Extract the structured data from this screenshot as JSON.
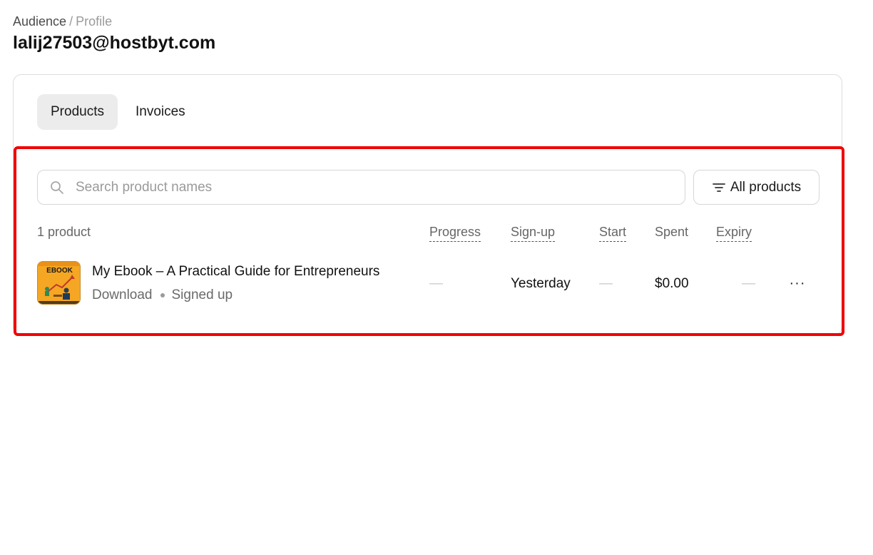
{
  "breadcrumb": {
    "parent": "Audience",
    "separator": "/",
    "current": "Profile"
  },
  "page_title": "lalij27503@hostbyt.com",
  "tabs": [
    {
      "label": "Products",
      "active": true
    },
    {
      "label": "Invoices",
      "active": false
    }
  ],
  "search": {
    "placeholder": "Search product names",
    "value": ""
  },
  "filter": {
    "label": "All products",
    "icon": "filter-lines-icon"
  },
  "table": {
    "count_label": "1 product",
    "columns": {
      "progress": "Progress",
      "signup": "Sign-up",
      "start": "Start",
      "spent": "Spent",
      "expiry": "Expiry"
    },
    "rows": [
      {
        "title": "My Ebook – A Practical Guide for Entrepreneurs",
        "type": "Download",
        "status": "Signed up",
        "progress": "—",
        "signup": "Yesterday",
        "start": "—",
        "spent": "$0.00",
        "expiry": "—",
        "thumbnail_text": "EBOOK",
        "more_label": "···"
      }
    ]
  },
  "colors": {
    "highlight": "#f00000",
    "tab_active_bg": "#ececec",
    "border": "#dddddd",
    "muted_text": "#666666",
    "thumbnail_bg": "#f5a623"
  }
}
